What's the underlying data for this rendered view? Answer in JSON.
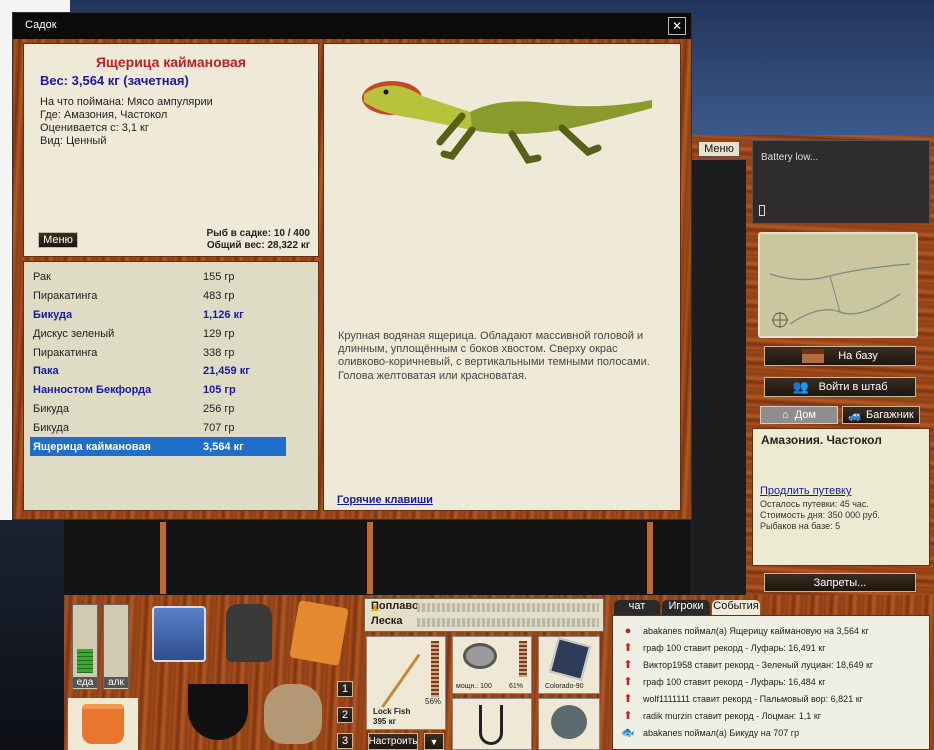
{
  "dialog": {
    "title": "Садок",
    "close": "✕"
  },
  "fish": {
    "name": "Ящерица каймановая",
    "weight": "Вес: 3,564 кг (зачетная)",
    "lines": [
      "На что поймана: Мясо ампулярии",
      "Где: Амазония, Частокол",
      "Оценивается с: 3,1 кг",
      "Вид: Ценный"
    ],
    "menu": "Меню",
    "count": "Рыб в садке: 10 / 400",
    "total": "Общий вес: 28,322 кг",
    "description": "Крупная водяная ящерица. Обладают массивной головой и длинным, уплощённым с боков хвостом. Сверху окрас оливково-коричневый, с вертикальными темными полосами. Голова желтоватая или красноватая.",
    "hotkeys": "Горячие клавиши"
  },
  "catch": [
    {
      "name": "Рак",
      "weight": "155 гр",
      "style": "normal"
    },
    {
      "name": "Пиракатинга",
      "weight": "483 гр",
      "style": "normal"
    },
    {
      "name": "Бикуда",
      "weight": "1,126 кг",
      "style": "bold"
    },
    {
      "name": "Дискус зеленый",
      "weight": "129 гр",
      "style": "normal"
    },
    {
      "name": "Пиракатинга",
      "weight": "338 гр",
      "style": "normal"
    },
    {
      "name": "Пака",
      "weight": "21,459 кг",
      "style": "bold"
    },
    {
      "name": "Нанностом Бекфорда",
      "weight": "105 гр",
      "style": "bold"
    },
    {
      "name": "Бикуда",
      "weight": "256 гр",
      "style": "normal"
    },
    {
      "name": "Бикуда",
      "weight": "707 гр",
      "style": "normal"
    },
    {
      "name": "Ящерица каймановая",
      "weight": "3,564 кг",
      "style": "selected"
    }
  ],
  "right": {
    "menu": "Меню",
    "battery": "Battery low...",
    "to_base": "На базу",
    "hq": "Войти в штаб",
    "tab_home": "Дом",
    "tab_trunk": "Багажник",
    "location": "Амазония. Частокол",
    "extend": "Продлить путевку",
    "left": "Осталось путевки: 45 час.",
    "cost": "Стоимость дня: 350 000 руб.",
    "anglers": "Рыбаков на базе: 5",
    "bans": "Запреты..."
  },
  "bottom": {
    "food": "еда",
    "alc": "алк",
    "nums": [
      "1",
      "2",
      "3"
    ],
    "float": "Поплавок",
    "line": "Леска",
    "rod": "Lock Fish",
    "rod_weight": "395 кг",
    "rod_pct": "56%",
    "reel_power": "мощн.: 100",
    "reel_pct": "61%",
    "bait": "Colorado-90",
    "setup": "Настроить",
    "down_arrow": "▼"
  },
  "chat": {
    "tabs": [
      "чат",
      "Игроки",
      "События"
    ],
    "events": [
      "abakanes поймал(а) Ящерицу каймановую на 3,564 кг",
      "граф 100 ставит рекорд - Луфарь: 16,491 кг",
      "Виктор1958 ставит рекорд - Зеленый луциан: 18,649 кг",
      "граф 100 ставит рекорд - Луфарь: 16,484 кг",
      "wolf1111111 ставит рекорд - Пальмовый вор: 6,821 кг",
      "radik murzin ставит рекорд - Лоцман: 1,1 кг",
      "abakanes поймал(а) Бикуду на 707 гр"
    ]
  },
  "colors": {
    "accent": "#c02020",
    "link": "#1a1aa0",
    "selected": "#1f6fc8"
  }
}
